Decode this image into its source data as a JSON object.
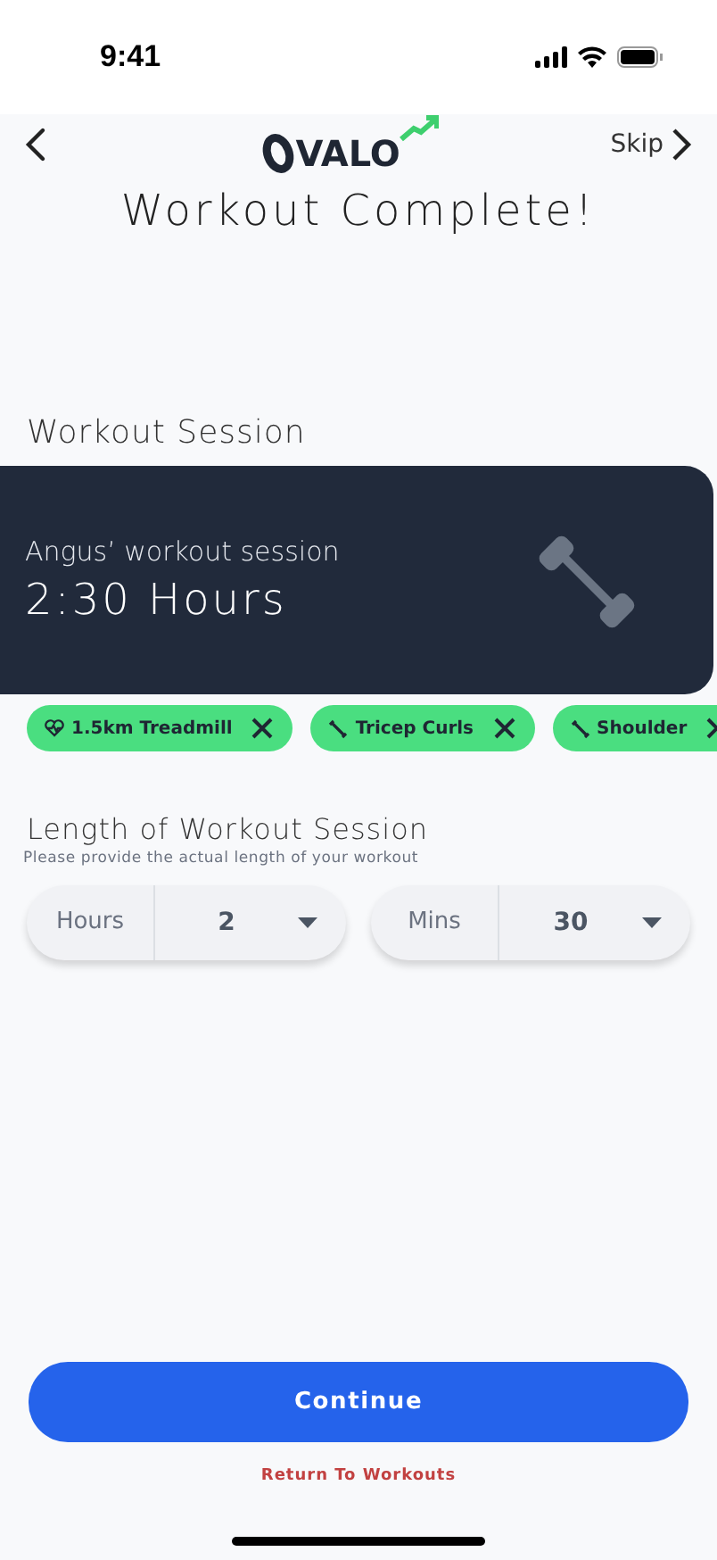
{
  "status_bar": {
    "time": "9:41"
  },
  "nav": {
    "logo": "VALO",
    "skip": "Skip"
  },
  "title": "Workout Complete!",
  "session": {
    "heading": "Workout Session",
    "owner": "Angus’ workout session",
    "duration": "2:30 Hours"
  },
  "exercises": [
    {
      "label": "1.5km Treadmill",
      "kind": "cardio"
    },
    {
      "label": "Tricep Curls",
      "kind": "strength"
    },
    {
      "label": "Shoulder",
      "kind": "strength"
    }
  ],
  "length": {
    "heading": "Length of Workout Session",
    "hint": "Please provide the actual length of your workout",
    "selects": [
      {
        "label": "Hours",
        "value": "2"
      },
      {
        "label": "Mins",
        "value": "30"
      }
    ]
  },
  "buttons": {
    "continue": "Continue",
    "return": "Return To Workouts"
  }
}
